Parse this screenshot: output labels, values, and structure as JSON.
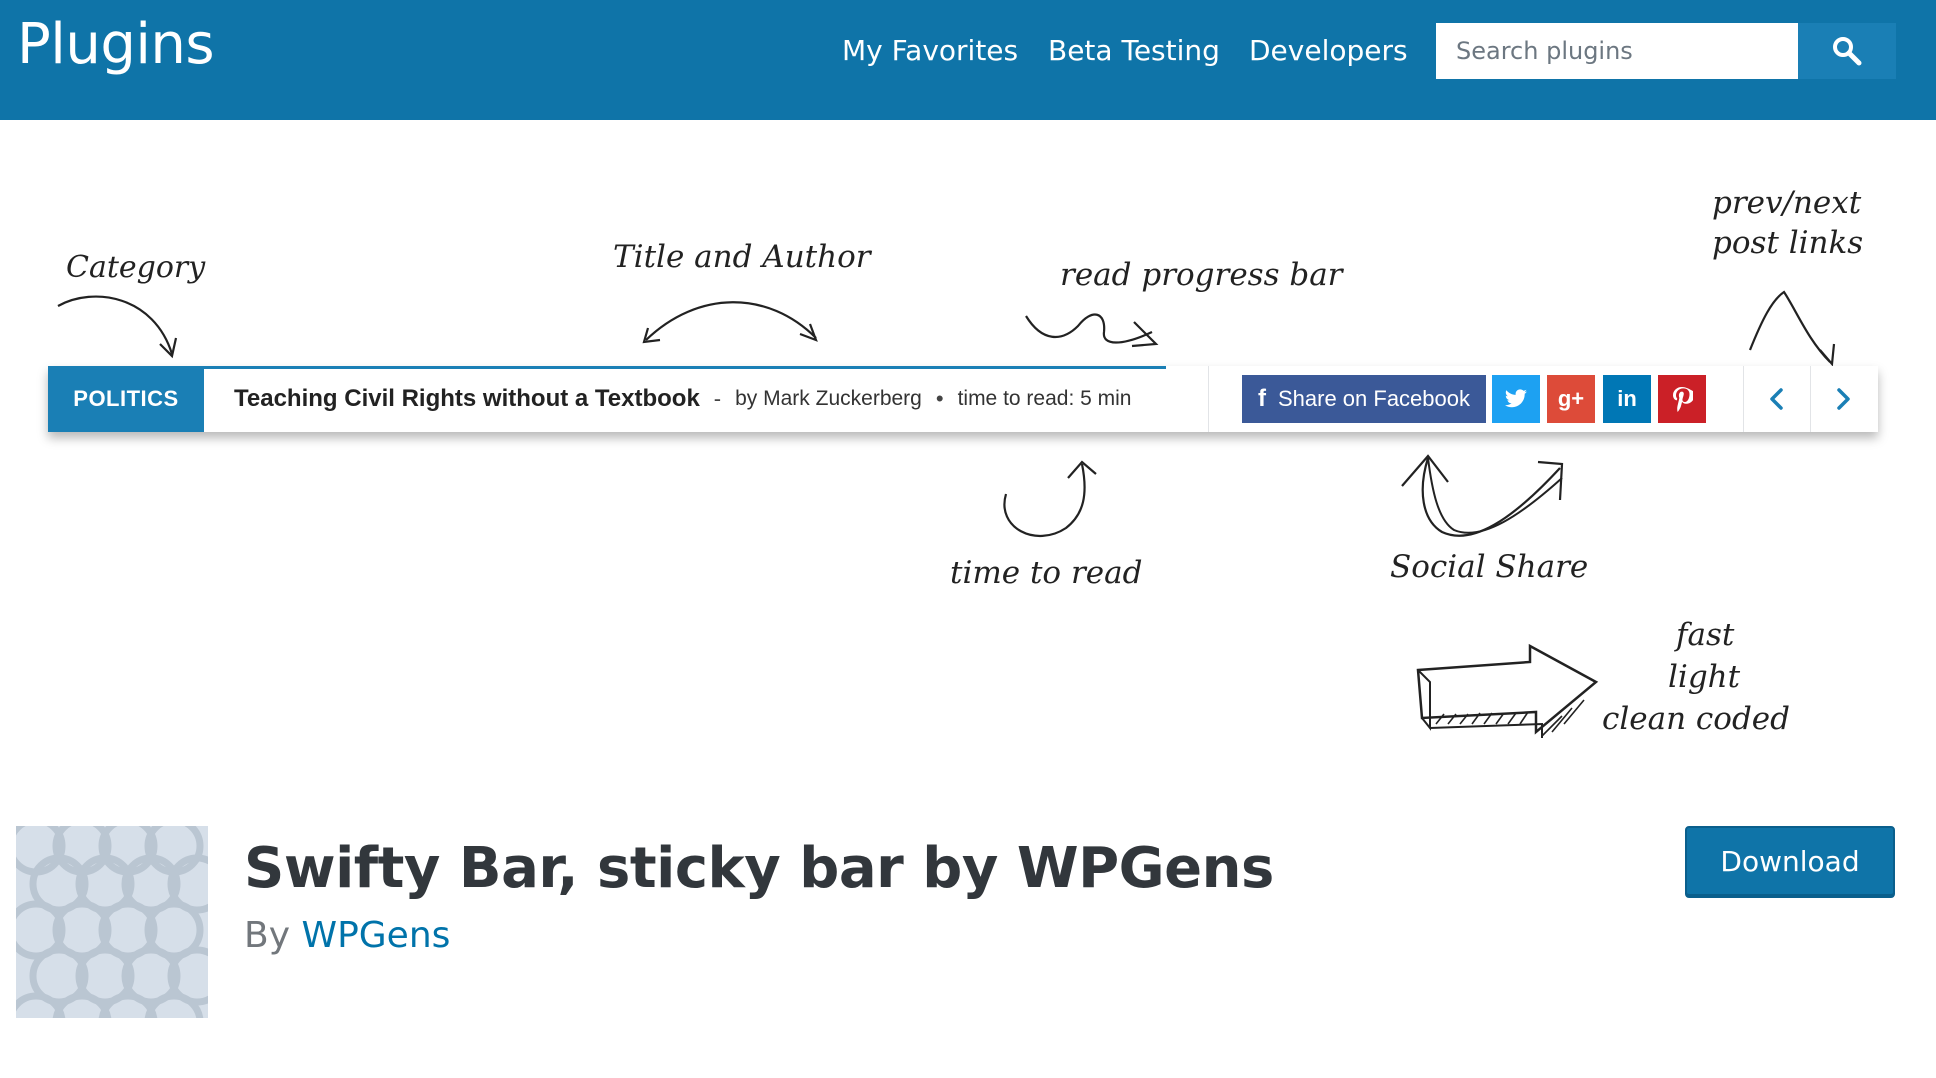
{
  "header": {
    "site_title": "Plugins",
    "nav": {
      "favorites": "My Favorites",
      "beta": "Beta Testing",
      "developers": "Developers"
    },
    "search": {
      "placeholder": "Search plugins",
      "icon": "search-icon"
    },
    "background": "#0f74a8"
  },
  "banner": {
    "annotations": {
      "category": "Category",
      "title_author": "Title and Author",
      "progress": "read progress bar",
      "prevnext_line1": "prev/next",
      "prevnext_line2": "post links",
      "time_to_read": "time to read",
      "social_share": "Social Share",
      "fast": "fast",
      "light": "light",
      "clean": "clean coded"
    },
    "demo_bar": {
      "category": "POLITICS",
      "title": "Teaching Civil Rights without a Textbook",
      "separator_dash": "-",
      "author": "by Mark Zuckerberg",
      "separator_dot": "•",
      "time": "time to read: 5 min",
      "facebook_label": "Share on Facebook",
      "facebook_glyph": "f",
      "googleplus_glyph": "g+",
      "linkedin_glyph": "in",
      "accent": "#1a7fb5",
      "share_colors": {
        "facebook": "#3b5998",
        "twitter": "#1da1f2",
        "googleplus": "#dd4b39",
        "linkedin": "#0077b5",
        "pinterest": "#cb2027"
      }
    }
  },
  "plugin": {
    "title": "Swifty Bar, sticky bar by WPGens",
    "by": "By",
    "author": "WPGens",
    "download": "Download"
  }
}
